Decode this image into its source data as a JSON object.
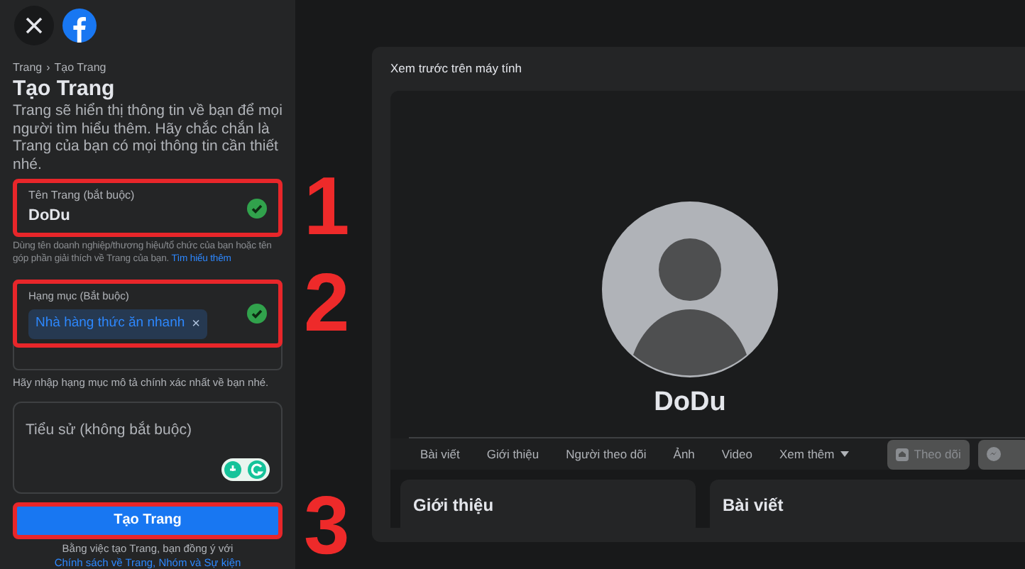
{
  "breadcrumb": {
    "items": [
      "Trang",
      "Tạo Trang"
    ],
    "separator": "›"
  },
  "title": "Tạo Trang",
  "description": "Trang sẽ hiển thị thông tin về bạn để mọi người tìm hiểu thêm. Hãy chắc chắn là Trang của bạn có mọi thông tin cần thiết nhé.",
  "fields": [
    {
      "kind": "text",
      "label": "Tên Trang (bắt buộc)",
      "value": "DoDu",
      "valid": true,
      "highlighted": true,
      "annotation": "1",
      "helper": "Dùng tên doanh nghiệp/thương hiệu/tổ chức của bạn hoặc tên góp phần giải thích về Trang của bạn.",
      "helper_link": "Tìm hiểu thêm"
    },
    {
      "kind": "tags",
      "label": "Hạng mục (Bắt buộc)",
      "tags": [
        {
          "text": "Nhà hàng thức ăn nhanh",
          "remove": "×"
        }
      ],
      "valid": true,
      "highlighted": true,
      "annotation": "2",
      "helper": "Hãy nhập hạng mục mô tả chính xác nhất về bạn nhé."
    },
    {
      "kind": "textarea",
      "placeholder": "Tiểu sử (không bắt buộc)",
      "highlighted": false
    }
  ],
  "submit": {
    "label": "Tạo Trang",
    "highlighted": true,
    "annotation": "3"
  },
  "footer": {
    "text": "Bằng việc tạo Trang, bạn đồng ý với",
    "link": "Chính sách về Trang, Nhóm và Sự kiện"
  },
  "preview": {
    "title": "Xem trước trên máy tính",
    "page_name": "DoDu",
    "tabs": [
      {
        "label": "Bài viết",
        "kind": "plain"
      },
      {
        "label": "Giới thiệu",
        "kind": "plain"
      },
      {
        "label": "Người theo dõi",
        "kind": "plain"
      },
      {
        "label": "Ảnh",
        "kind": "plain"
      },
      {
        "label": "Video",
        "kind": "plain"
      },
      {
        "label": "Xem thêm",
        "kind": "dropdown"
      }
    ],
    "actions": [
      {
        "kind": "follow",
        "label": "Theo dõi",
        "disabled": true
      },
      {
        "kind": "message",
        "disabled": true
      }
    ],
    "sections": [
      "Giới thiệu",
      "Bài viết"
    ]
  }
}
